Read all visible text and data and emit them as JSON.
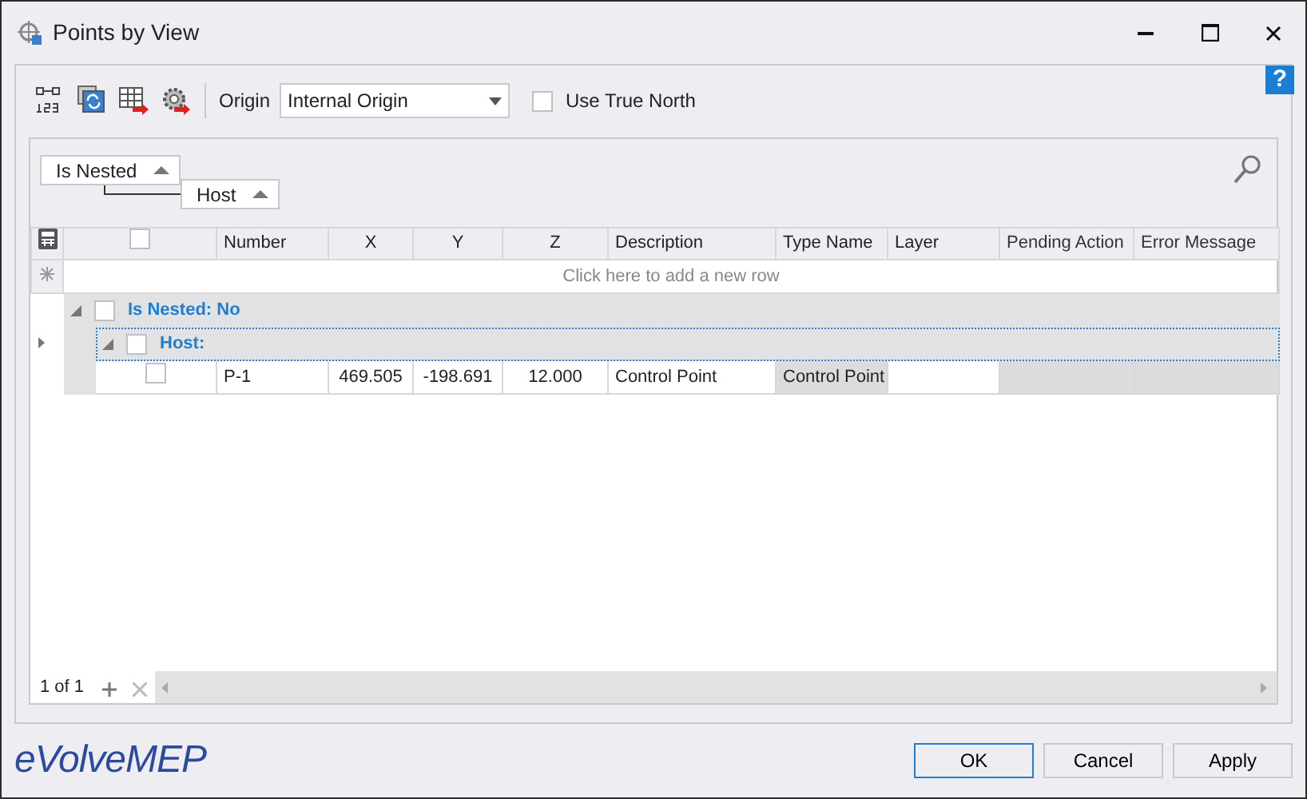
{
  "window": {
    "title": "Points by View"
  },
  "toolbar": {
    "origin_label": "Origin",
    "origin_value": "Internal Origin",
    "true_north": {
      "label": "Use True North",
      "checked": false
    }
  },
  "help": "?",
  "group_panel": [
    {
      "label": "Is Nested"
    },
    {
      "label": "Host"
    }
  ],
  "table": {
    "select_all_checked": false,
    "columns": [
      {
        "label": "Number",
        "readonly": false
      },
      {
        "label": "X",
        "readonly": false
      },
      {
        "label": "Y",
        "readonly": false
      },
      {
        "label": "Z",
        "readonly": false
      },
      {
        "label": "Description",
        "readonly": false
      },
      {
        "label": "Type Name",
        "readonly": false
      },
      {
        "label": "Layer",
        "readonly": false
      },
      {
        "label": "Pending Action",
        "readonly": true
      },
      {
        "label": "Error Message",
        "readonly": true
      }
    ],
    "new_row_prompt": "Click here to add a new row",
    "groups": [
      {
        "label": "Is Nested: No",
        "checked": false,
        "expanded": true,
        "focused": false,
        "children": [
          {
            "label": "Host:",
            "checked": false,
            "expanded": true,
            "focused": true,
            "rows": [
              {
                "checked": false,
                "cells": [
                  {
                    "text": "P-1",
                    "focused": false
                  },
                  {
                    "text": "469.505",
                    "focused": false
                  },
                  {
                    "text": "-198.691",
                    "focused": false
                  },
                  {
                    "text": "12.000",
                    "focused": false
                  },
                  {
                    "text": "Control Point",
                    "focused": false
                  },
                  {
                    "text": "Control Point",
                    "focused": true
                  }
                ]
              }
            ]
          }
        ]
      }
    ]
  },
  "pager": "1 of 1",
  "logo": "eVolveMEP",
  "buttons": [
    {
      "label": "OK",
      "default": true
    },
    {
      "label": "Cancel",
      "default": false
    },
    {
      "label": "Apply",
      "default": false
    }
  ]
}
